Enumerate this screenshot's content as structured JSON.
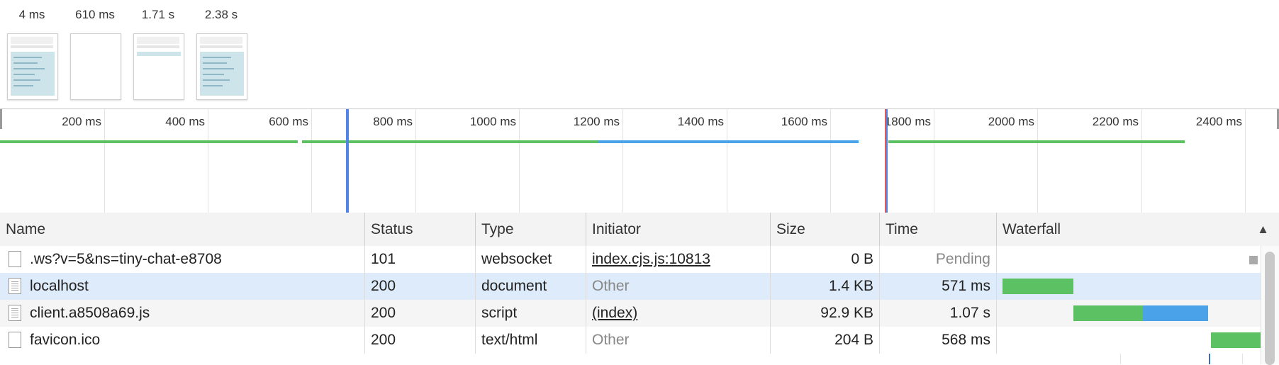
{
  "filmstrip": {
    "frames": [
      {
        "time": "4 ms",
        "state": "loaded"
      },
      {
        "time": "610 ms",
        "state": "blank"
      },
      {
        "time": "1.71 s",
        "state": "partial"
      },
      {
        "time": "2.38 s",
        "state": "loaded"
      }
    ]
  },
  "overview": {
    "ticks": [
      "200 ms",
      "400 ms",
      "600 ms",
      "800 ms",
      "1000 ms",
      "1200 ms",
      "1400 ms",
      "1600 ms",
      "1800 ms",
      "2000 ms",
      "2200 ms",
      "2400 ms"
    ],
    "colors": {
      "green": "#5cc162",
      "blue": "#4aa3e8",
      "dom_marker": "#4f86e8",
      "load_marker": "#e8584f"
    }
  },
  "table": {
    "headers": {
      "name": "Name",
      "status": "Status",
      "type": "Type",
      "initiator": "Initiator",
      "size": "Size",
      "time": "Time",
      "waterfall": "Waterfall",
      "sort": "▲"
    },
    "rows": [
      {
        "name": ".ws?v=5&ns=tiny-chat-e8708",
        "status": "101",
        "type": "websocket",
        "initiator": "index.cjs.js:10813",
        "size": "0 B",
        "time": "Pending"
      },
      {
        "name": "localhost",
        "status": "200",
        "type": "document",
        "initiator": "Other",
        "size": "1.4 KB",
        "time": "571 ms"
      },
      {
        "name": "client.a8508a69.js",
        "status": "200",
        "type": "script",
        "initiator": "(index)",
        "size": "92.9 KB",
        "time": "1.07 s"
      },
      {
        "name": "favicon.ico",
        "status": "200",
        "type": "text/html",
        "initiator": "Other",
        "size": "204 B",
        "time": "568 ms"
      }
    ]
  }
}
